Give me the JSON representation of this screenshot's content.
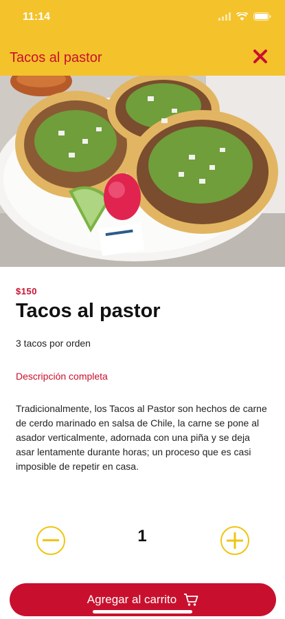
{
  "status_bar": {
    "time": "11:14"
  },
  "header": {
    "title": "Tacos al pastor",
    "close_icon": "close-icon",
    "background": "#f4c22b",
    "accent": "#c8102e"
  },
  "product": {
    "image_alt": "Tacos al pastor",
    "price": "$150",
    "title": "Tacos al pastor",
    "subtitle": "3 tacos por orden",
    "description_link": "Descripción completa",
    "description": "Tradicionalmente, los Tacos al Pastor son hechos de carne de cerdo marinado en salsa de Chile, la carne se pone al asador verticalmente, adornada con una piña y se deja asar lentamente durante horas; un proceso que es casi imposible de repetir en casa."
  },
  "quantity": {
    "value": "1",
    "minus_icon": "minus-circle-icon",
    "plus_icon": "plus-circle-icon"
  },
  "cart_button": {
    "label": "Agregar al carrito",
    "icon": "cart-icon"
  }
}
